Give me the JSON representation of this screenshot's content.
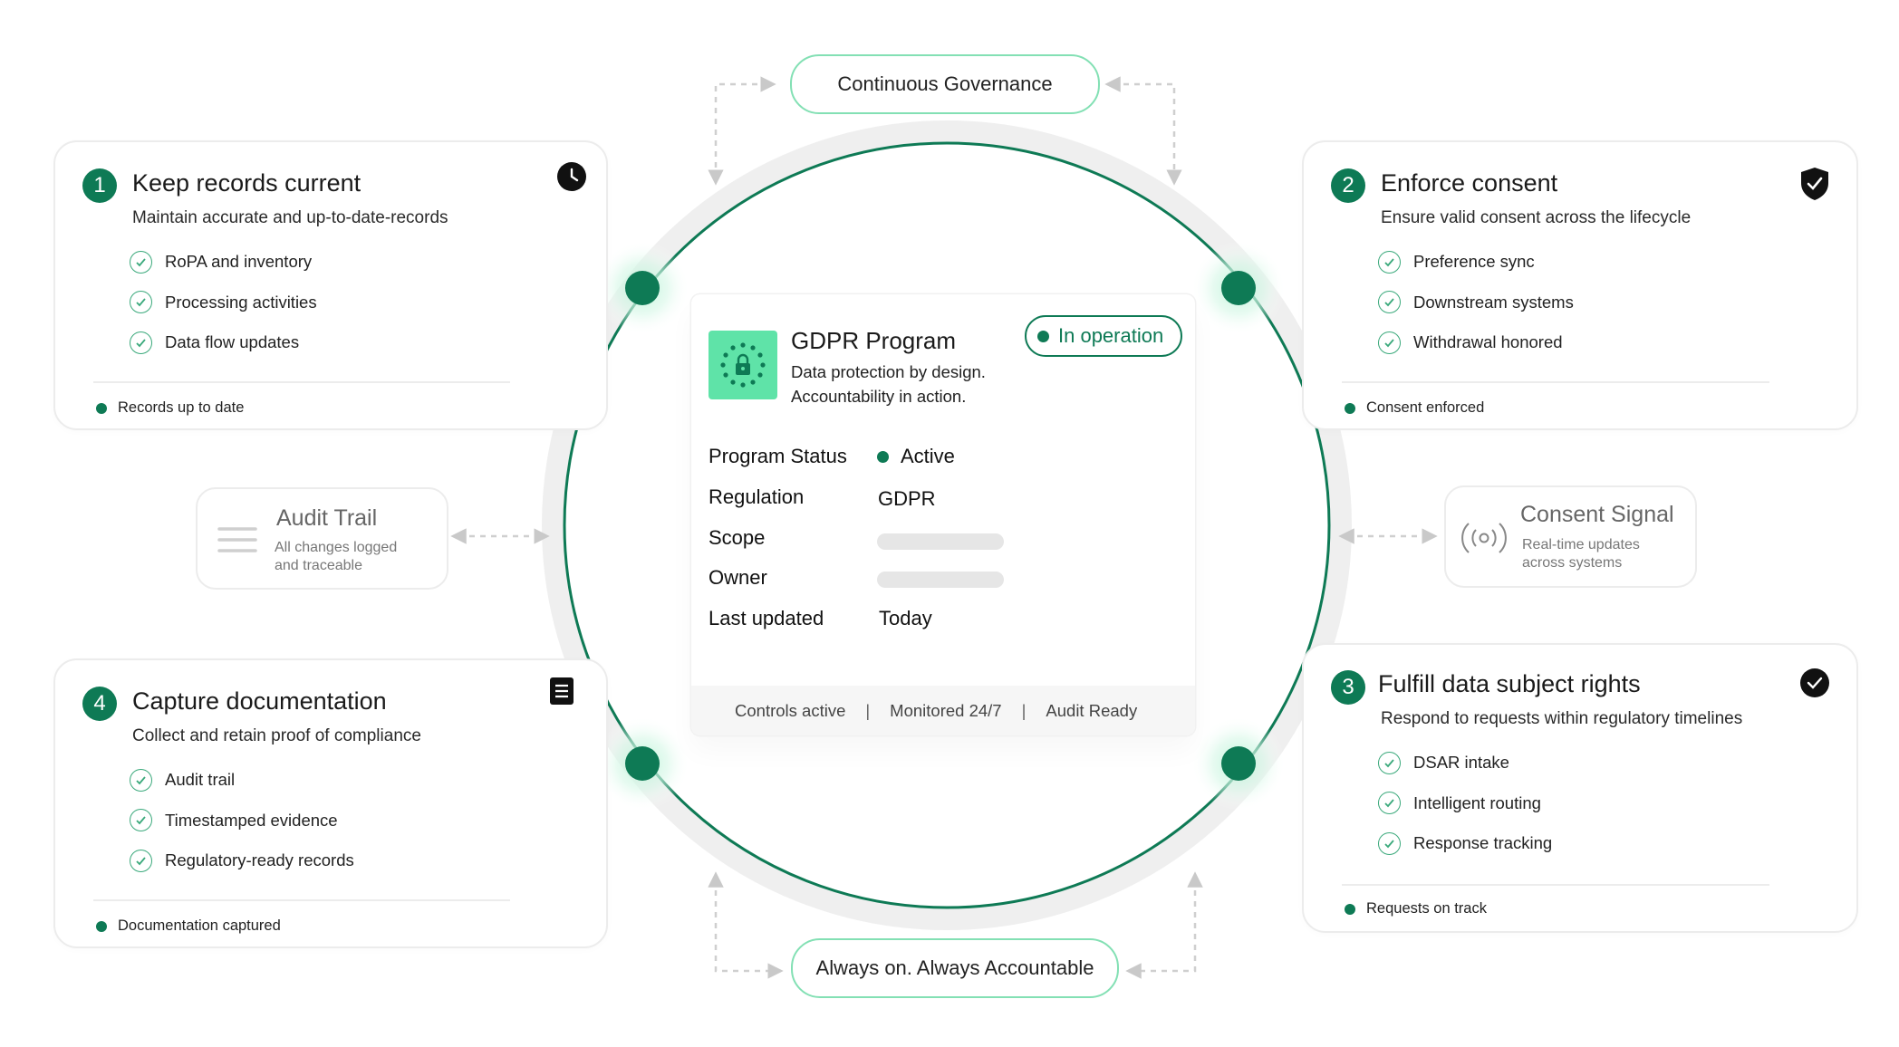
{
  "top_pill": "Continuous Governance",
  "bottom_pill": "Always on. Always Accountable",
  "cards": [
    {
      "number": "1",
      "title": "Keep records current",
      "subtitle": "Maintain accurate and up-to-date-records",
      "badge_icon": "clock-icon",
      "items": [
        "RoPA and inventory",
        "Processing activities",
        "Data flow updates"
      ],
      "footer": "Records up to date"
    },
    {
      "number": "2",
      "title": "Enforce consent",
      "subtitle": "Ensure valid consent across the lifecycle",
      "badge_icon": "shield-check-icon",
      "items": [
        "Preference sync",
        "Downstream systems",
        "Withdrawal honored"
      ],
      "footer": "Consent enforced"
    },
    {
      "number": "3",
      "title": "Fulfill data subject rights",
      "subtitle": "Respond to requests within regulatory timelines",
      "badge_icon": "check-circle-icon",
      "items": [
        "DSAR intake",
        "Intelligent routing",
        "Response tracking"
      ],
      "footer": "Requests on track"
    },
    {
      "number": "4",
      "title": "Capture documentation",
      "subtitle": "Collect and retain proof of compliance",
      "badge_icon": "document-icon",
      "items": [
        "Audit trail",
        "Timestamped evidence",
        "Regulatory-ready records"
      ],
      "footer": "Documentation captured"
    }
  ],
  "side_left": {
    "title": "Audit Trail",
    "description": "All changes logged and traceable",
    "icon": "lines-icon"
  },
  "side_right": {
    "title": "Consent Signal",
    "description": "Real-time updates across systems",
    "icon": "signal-icon"
  },
  "program": {
    "title": "GDPR Program",
    "description": "Data protection by design. Accountability in action.",
    "status_pill": "In operation",
    "logo_icon": "eu-stars-lock-icon",
    "rows": [
      {
        "label": "Program Status",
        "value": "Active"
      },
      {
        "label": "Regulation",
        "value": "GDPR"
      },
      {
        "label": "Scope",
        "value": ""
      },
      {
        "label": "Owner",
        "value": ""
      },
      {
        "label": "Last updated",
        "value": "Today"
      }
    ],
    "footer": [
      "Controls active",
      "Monitored 24/7",
      "Audit Ready"
    ],
    "footer_separator": "|"
  },
  "colors": {
    "accent": "#0e7a55",
    "accent_light": "#83e0b4",
    "logo_bg": "#5fe3a8"
  }
}
